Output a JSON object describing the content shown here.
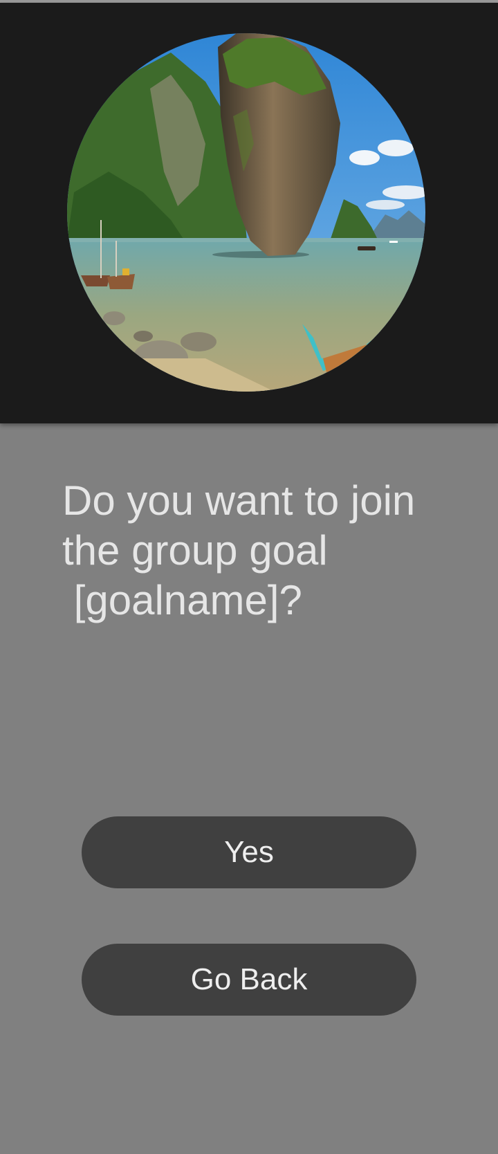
{
  "dialog": {
    "question": "Do you want to join\nthe group goal\n [goalname]?"
  },
  "actions": {
    "yes_label": "Yes",
    "back_label": "Go Back"
  },
  "colors": {
    "header_background": "#1b1b1b",
    "page_background": "#808080",
    "button_background": "#404040",
    "text": "#e6e6e6"
  },
  "image": {
    "icon": "goal-photo-rock-island-lagoon"
  }
}
